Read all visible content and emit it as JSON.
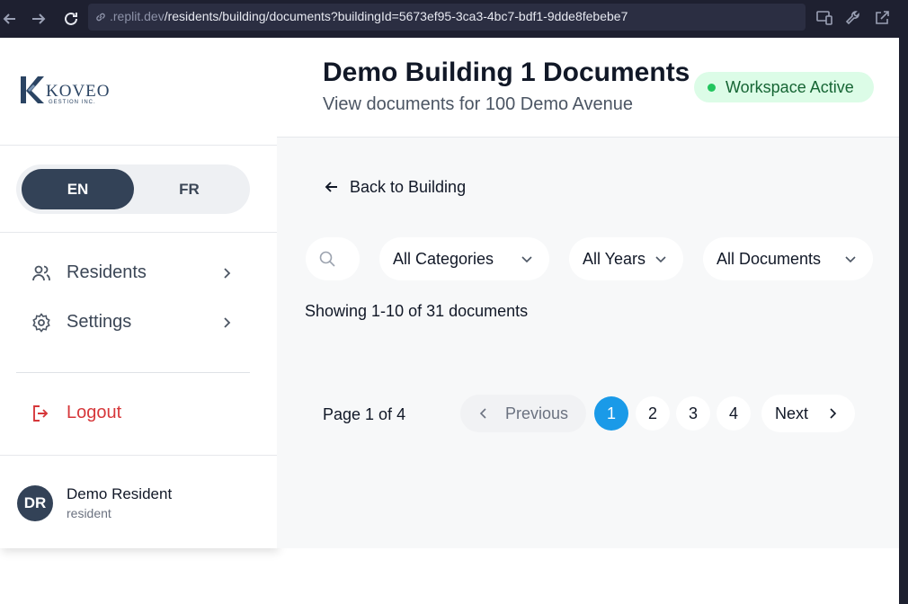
{
  "browser": {
    "url_prefix": ".replit.dev",
    "url_path": "/residents/building/documents?buildingId=5673ef95-3ca3-4bc7-bdf1-9dde8febebe7"
  },
  "sidebar": {
    "logo": {
      "word": "KOVEO",
      "sub": "GESTION INC."
    },
    "language": {
      "en": "EN",
      "fr": "FR",
      "selected": "EN"
    },
    "menu": [
      {
        "label": "Residents",
        "icon": "users-icon"
      },
      {
        "label": "Settings",
        "icon": "gear-icon"
      }
    ],
    "logout_label": "Logout",
    "user": {
      "initials": "DR",
      "name": "Demo Resident",
      "role": "resident"
    }
  },
  "header": {
    "title": "Demo Building 1 Documents",
    "subtitle": "View documents for 100 Demo Avenue",
    "status": "Workspace Active"
  },
  "main": {
    "back_label": "Back to Building",
    "filters": {
      "category": "All Categories",
      "year": "All Years",
      "documents": "All Documents"
    },
    "results": "Showing 1-10 of 31 documents",
    "pagination": {
      "page_info": "Page 1 of 4",
      "previous": "Previous",
      "next": "Next",
      "pages": [
        "1",
        "2",
        "3",
        "4"
      ],
      "current": "1"
    }
  },
  "colors": {
    "sidebar_dark": "#334257",
    "accent": "#1a9ae8",
    "logout": "#d6373a",
    "status_bg": "#dcfce7",
    "status_dot": "#22c55e"
  }
}
